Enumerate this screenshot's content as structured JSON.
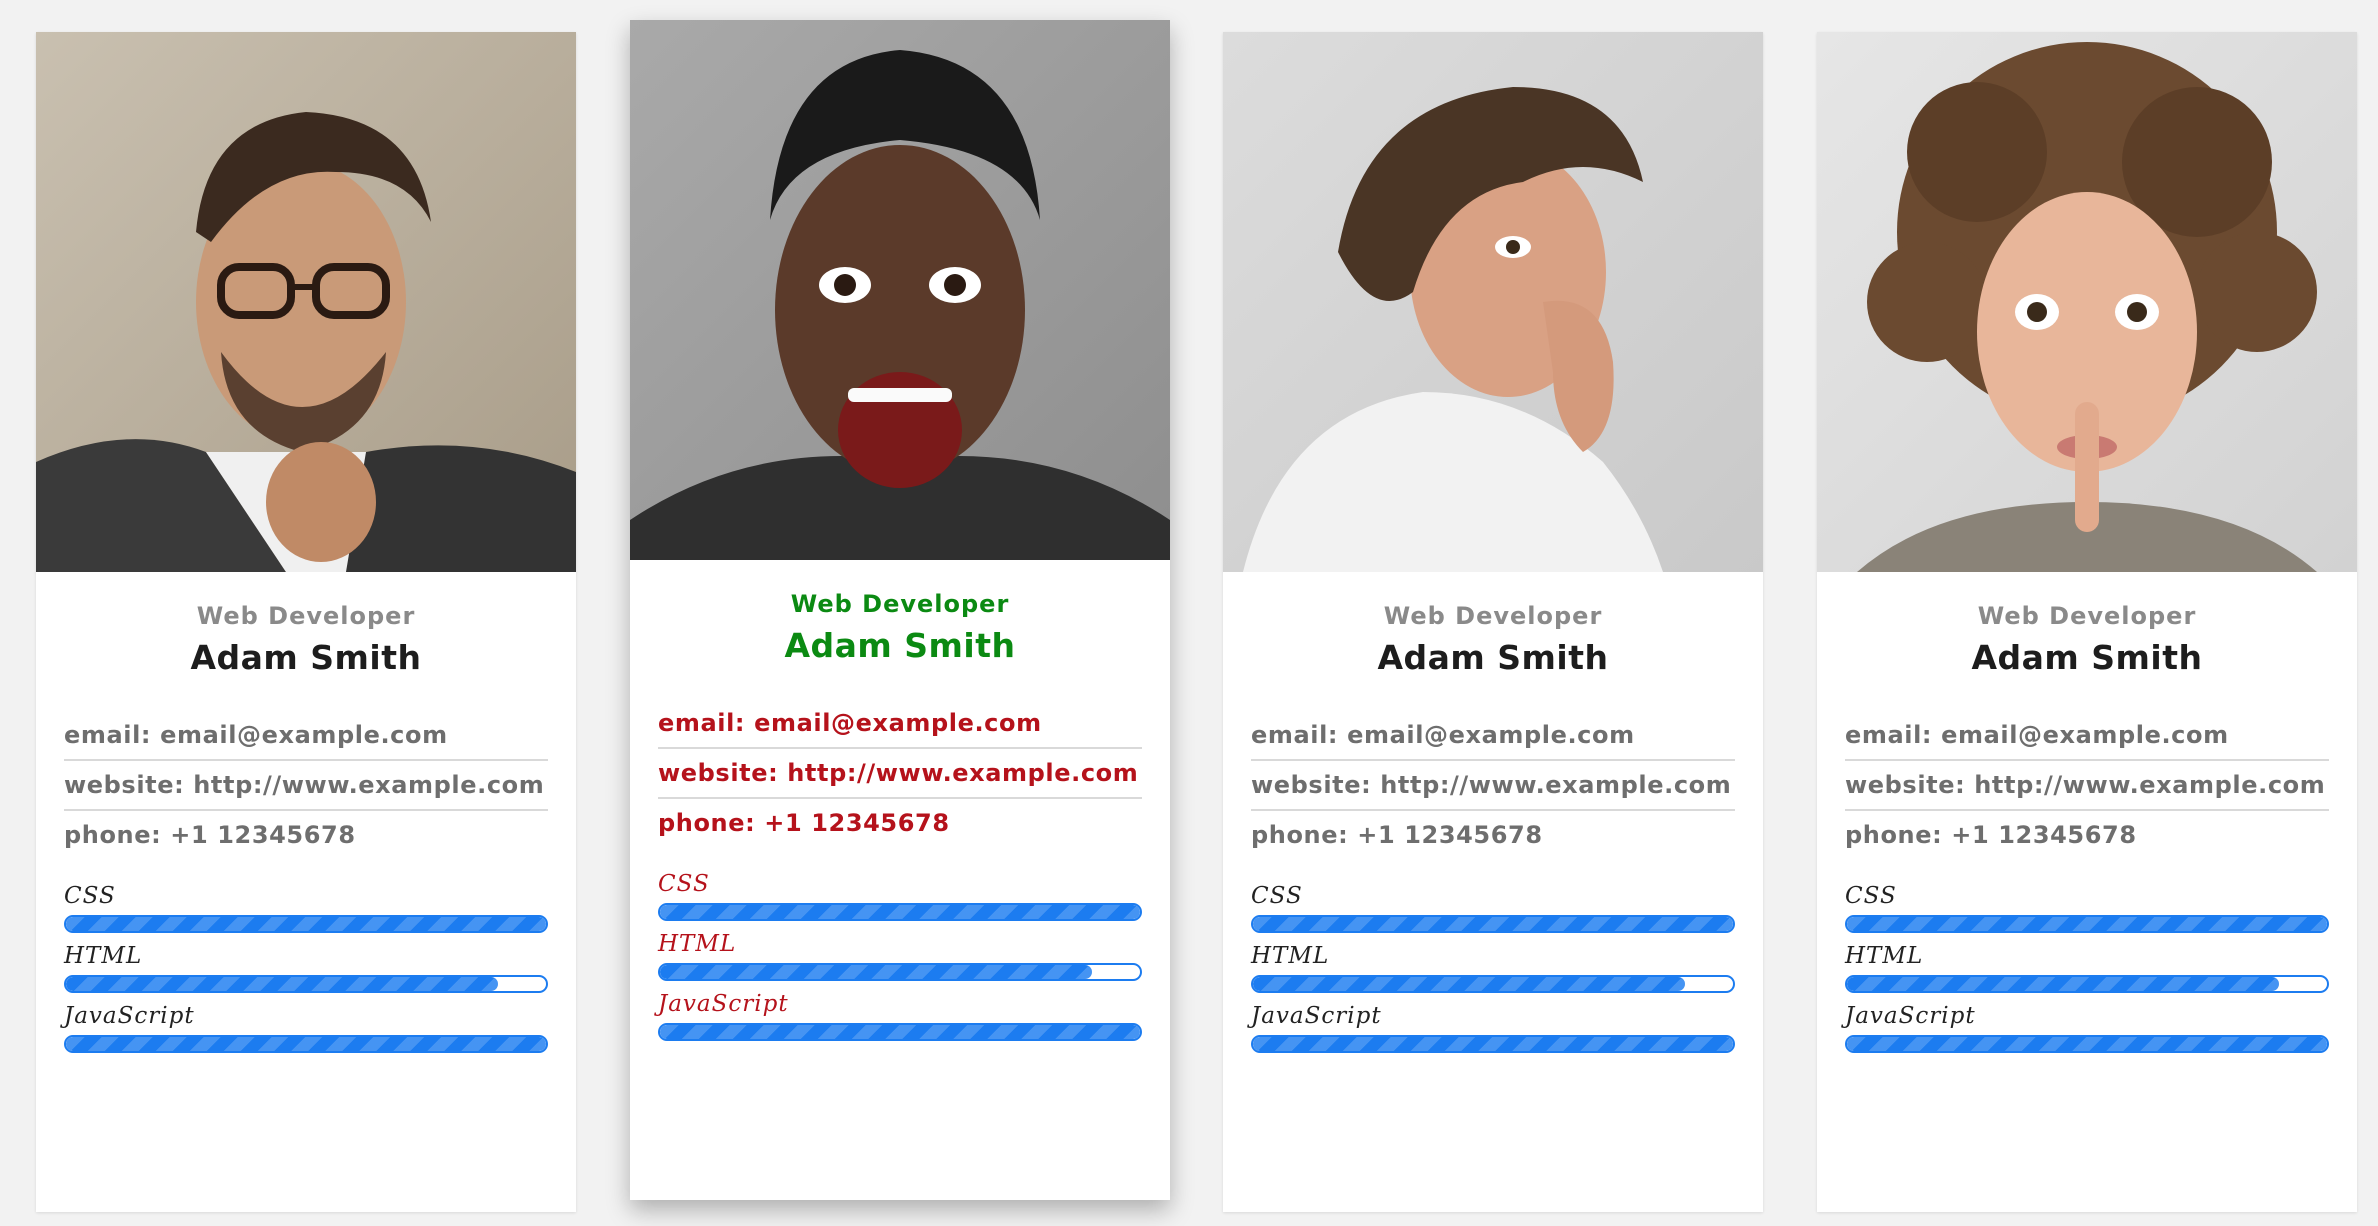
{
  "cards": [
    {
      "photo": "man-thinking-glasses-photo",
      "role": "Web Developer",
      "name": "Adam Smith",
      "email": "email: email@example.com",
      "website": "website: http://www.example.com",
      "phone": "phone: +1 12345678",
      "skills": [
        {
          "label": "CSS",
          "level": 1.0
        },
        {
          "label": "HTML",
          "level": 0.9
        },
        {
          "label": "JavaScript",
          "level": 1.0
        }
      ]
    },
    {
      "photo": "woman-surprised-photo",
      "role": "Web Developer",
      "name": "Adam Smith",
      "email": "email: email@example.com",
      "website": "website: http://www.example.com",
      "phone": "phone: +1 12345678",
      "skills": [
        {
          "label": "CSS",
          "level": 1.0
        },
        {
          "label": "HTML",
          "level": 0.9
        },
        {
          "label": "JavaScript",
          "level": 1.0
        }
      ]
    },
    {
      "photo": "man-nervous-photo",
      "role": "Web Developer",
      "name": "Adam Smith",
      "email": "email: email@example.com",
      "website": "website: http://www.example.com",
      "phone": "phone: +1 12345678",
      "skills": [
        {
          "label": "CSS",
          "level": 1.0
        },
        {
          "label": "HTML",
          "level": 0.9
        },
        {
          "label": "JavaScript",
          "level": 1.0
        }
      ]
    },
    {
      "photo": "woman-curly-hair-photo",
      "role": "Web Developer",
      "name": "Adam Smith",
      "email": "email: email@example.com",
      "website": "website: http://www.example.com",
      "phone": "phone: +1 12345678",
      "skills": [
        {
          "label": "CSS",
          "level": 1.0
        },
        {
          "label": "HTML",
          "level": 0.9
        },
        {
          "label": "JavaScript",
          "level": 1.0
        }
      ]
    }
  ],
  "active_card": 1,
  "colors": {
    "bar": "#1c7cf0",
    "active_title": "#0b8a12",
    "active_text": "#b5121b"
  }
}
